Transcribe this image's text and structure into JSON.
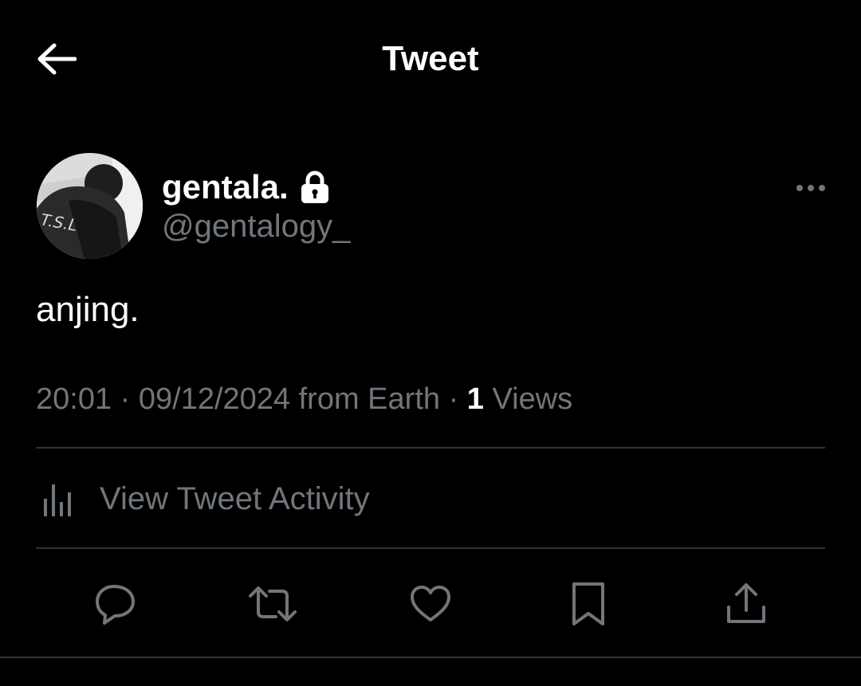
{
  "header": {
    "title": "Tweet",
    "back_icon": "arrow-left-icon"
  },
  "author": {
    "display_name": "gentala.",
    "handle": "@gentalogy_",
    "protected_icon": "lock-icon",
    "avatar_text": "T.S.L"
  },
  "tweet": {
    "text": "anjing.",
    "time": "20:01",
    "separator": "·",
    "date": "09/12/2024",
    "source": "from Earth",
    "views_count": "1",
    "views_label": "Views"
  },
  "activity": {
    "label": "View Tweet Activity",
    "icon": "analytics-bars-icon"
  },
  "actions": [
    {
      "name": "reply",
      "icon": "reply-icon"
    },
    {
      "name": "retweet",
      "icon": "retweet-icon"
    },
    {
      "name": "like",
      "icon": "heart-icon"
    },
    {
      "name": "bookmark",
      "icon": "bookmark-icon"
    },
    {
      "name": "share",
      "icon": "share-icon"
    }
  ],
  "colors": {
    "background": "#000000",
    "primary_text": "#ffffff",
    "secondary_text": "#71767b",
    "divider": "#2f3336"
  }
}
